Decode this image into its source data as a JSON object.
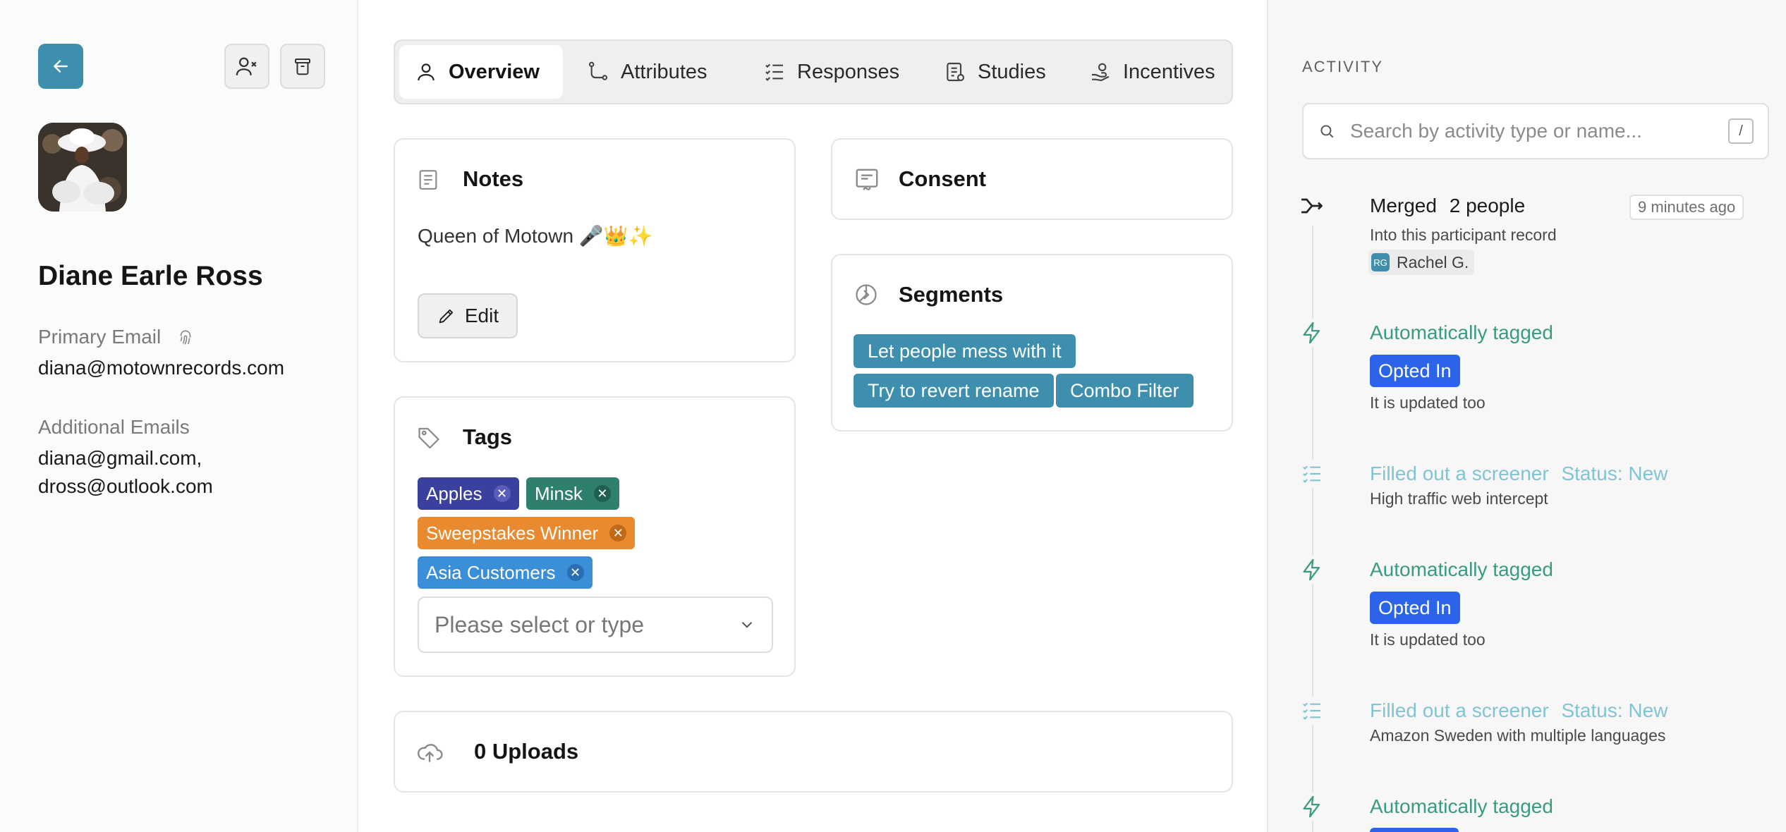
{
  "profile": {
    "name": "Diane Earle Ross",
    "primary_email_label": "Primary Email",
    "primary_email": "diana@motownrecords.com",
    "additional_emails_label": "Additional Emails",
    "additional_emails": [
      "diana@gmail.com,",
      "dross@outlook.com"
    ]
  },
  "tabs": [
    {
      "label": "Overview",
      "icon": "user-icon",
      "active": true
    },
    {
      "label": "Attributes",
      "icon": "path-icon"
    },
    {
      "label": "Responses",
      "icon": "list-check-icon"
    },
    {
      "label": "Studies",
      "icon": "clipboard-icon"
    },
    {
      "label": "Incentives",
      "icon": "hand-coin-icon"
    }
  ],
  "notes": {
    "title": "Notes",
    "text": "Queen of Motown 🎤👑✨",
    "edit_label": "Edit"
  },
  "tags": {
    "title": "Tags",
    "items": [
      {
        "label": "Apples",
        "color": "#3b3f9e"
      },
      {
        "label": "Minsk",
        "color": "#2e7f6e"
      },
      {
        "label": "Sweepstakes Winner",
        "color": "#e98a2f"
      },
      {
        "label": "Asia Customers",
        "color": "#3a8fd8"
      }
    ],
    "select_placeholder": "Please select or type"
  },
  "consent": {
    "title": "Consent"
  },
  "segments": {
    "title": "Segments",
    "items": [
      "Let people mess with it",
      "Try to revert rename",
      "Combo Filter"
    ]
  },
  "uploads": {
    "title": "0 Uploads"
  },
  "activity": {
    "heading": "ACTIVITY",
    "search_placeholder": "Search by activity type or name...",
    "search_shortcut": "/",
    "events": [
      {
        "icon": "merge-icon",
        "title": "Merged",
        "title_bold": "2 people",
        "subtitle": "Into this participant record",
        "time": "9 minutes ago",
        "user_initials": "RG",
        "user": "Rachel G."
      },
      {
        "icon": "bolt-icon",
        "title": "Automatically tagged",
        "badge": "Opted In",
        "subtitle": "It is updated too"
      },
      {
        "icon": "list-check-icon",
        "title": "Filled out a screener",
        "status": "Status: New",
        "subtitle": "High traffic web intercept"
      },
      {
        "icon": "bolt-icon",
        "title": "Automatically tagged",
        "badge": "Opted In",
        "subtitle": "It is updated too"
      },
      {
        "icon": "list-check-icon",
        "title": "Filled out a screener",
        "status": "Status: New",
        "subtitle": "Amazon Sweden with multiple languages"
      },
      {
        "icon": "bolt-icon",
        "title": "Automatically tagged"
      }
    ]
  },
  "colors": {
    "accent": "#3e8fae",
    "green": "#3b9a80",
    "light_teal": "#82c3d4",
    "blue_badge": "#2b64e8"
  }
}
